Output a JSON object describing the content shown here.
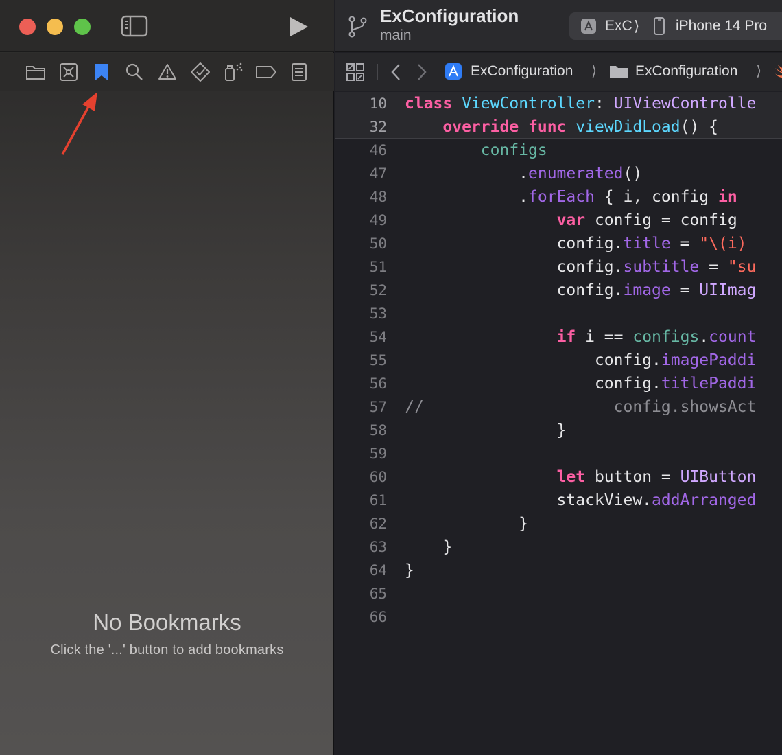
{
  "window": {
    "project_title": "ExConfiguration",
    "branch": "main",
    "scheme_name": "ExC",
    "scheme_separator": "⟩",
    "device": "iPhone 14 Pro"
  },
  "navigator": {
    "tabs": [
      "project-navigator",
      "source-control-navigator",
      "bookmark-navigator",
      "find-navigator",
      "issue-navigator",
      "test-navigator",
      "debug-navigator",
      "breakpoint-navigator",
      "report-navigator"
    ],
    "selected_tab": "bookmark-navigator",
    "empty_title": "No Bookmarks",
    "empty_subtitle": "Click the '...' button to add bookmarks"
  },
  "jump_bar": {
    "crumbs": [
      "ExConfiguration",
      "ExConfiguration"
    ],
    "separator": "⟩"
  },
  "editor": {
    "lines": [
      {
        "n": "10",
        "sticky": true,
        "tokens": [
          [
            "kw",
            "class"
          ],
          [
            "p",
            " "
          ],
          [
            "cls",
            "ViewController"
          ],
          [
            "p",
            ": "
          ],
          [
            "ty",
            "UIViewControlle"
          ]
        ]
      },
      {
        "n": "32",
        "sticky": true,
        "tokens": [
          [
            "p",
            "    "
          ],
          [
            "kw",
            "override"
          ],
          [
            "p",
            " "
          ],
          [
            "kw",
            "func"
          ],
          [
            "p",
            " "
          ],
          [
            "cls",
            "viewDidLoad"
          ],
          [
            "p",
            "() {"
          ]
        ]
      },
      {
        "n": "46",
        "tokens": [
          [
            "p",
            "        "
          ],
          [
            "var",
            "configs"
          ]
        ]
      },
      {
        "n": "47",
        "tokens": [
          [
            "p",
            "            ."
          ],
          [
            "fn",
            "enumerated"
          ],
          [
            "p",
            "()"
          ]
        ]
      },
      {
        "n": "48",
        "tokens": [
          [
            "p",
            "            ."
          ],
          [
            "fn",
            "forEach"
          ],
          [
            "p",
            " { i, config "
          ],
          [
            "kw",
            "in"
          ]
        ]
      },
      {
        "n": "49",
        "tokens": [
          [
            "p",
            "                "
          ],
          [
            "kw",
            "var"
          ],
          [
            "p",
            " config = config"
          ]
        ]
      },
      {
        "n": "50",
        "tokens": [
          [
            "p",
            "                config."
          ],
          [
            "fn",
            "title"
          ],
          [
            "p",
            " = "
          ],
          [
            "str",
            "\"\\(i)"
          ]
        ]
      },
      {
        "n": "51",
        "tokens": [
          [
            "p",
            "                config."
          ],
          [
            "fn",
            "subtitle"
          ],
          [
            "p",
            " = "
          ],
          [
            "str",
            "\"su"
          ]
        ]
      },
      {
        "n": "52",
        "tokens": [
          [
            "p",
            "                config."
          ],
          [
            "fn",
            "image"
          ],
          [
            "p",
            " = "
          ],
          [
            "ty",
            "UIImag"
          ]
        ]
      },
      {
        "n": "53",
        "tokens": []
      },
      {
        "n": "54",
        "tokens": [
          [
            "p",
            "                "
          ],
          [
            "kw",
            "if"
          ],
          [
            "p",
            " i == "
          ],
          [
            "var",
            "configs"
          ],
          [
            "p",
            "."
          ],
          [
            "fn",
            "count"
          ]
        ]
      },
      {
        "n": "55",
        "tokens": [
          [
            "p",
            "                    config."
          ],
          [
            "fn",
            "imagePaddi"
          ]
        ]
      },
      {
        "n": "56",
        "tokens": [
          [
            "p",
            "                    config."
          ],
          [
            "fn",
            "titlePaddi"
          ]
        ]
      },
      {
        "n": "57",
        "tokens": [
          [
            "cm",
            "//                    config.showsAct"
          ]
        ]
      },
      {
        "n": "58",
        "tokens": [
          [
            "p",
            "                }"
          ]
        ]
      },
      {
        "n": "59",
        "tokens": []
      },
      {
        "n": "60",
        "tokens": [
          [
            "p",
            "                "
          ],
          [
            "kw",
            "let"
          ],
          [
            "p",
            " button = "
          ],
          [
            "ty",
            "UIButton"
          ]
        ]
      },
      {
        "n": "61",
        "tokens": [
          [
            "p",
            "                stackView."
          ],
          [
            "fn",
            "addArranged"
          ]
        ]
      },
      {
        "n": "62",
        "tokens": [
          [
            "p",
            "            }"
          ]
        ]
      },
      {
        "n": "63",
        "tokens": [
          [
            "p",
            "    }"
          ]
        ]
      },
      {
        "n": "64",
        "tokens": [
          [
            "p",
            "}"
          ]
        ]
      },
      {
        "n": "65",
        "tokens": []
      },
      {
        "n": "66",
        "tokens": []
      }
    ]
  },
  "colors": {
    "accent_selected_tab": "#3c84f5",
    "annotation_arrow": "#e5412f"
  }
}
